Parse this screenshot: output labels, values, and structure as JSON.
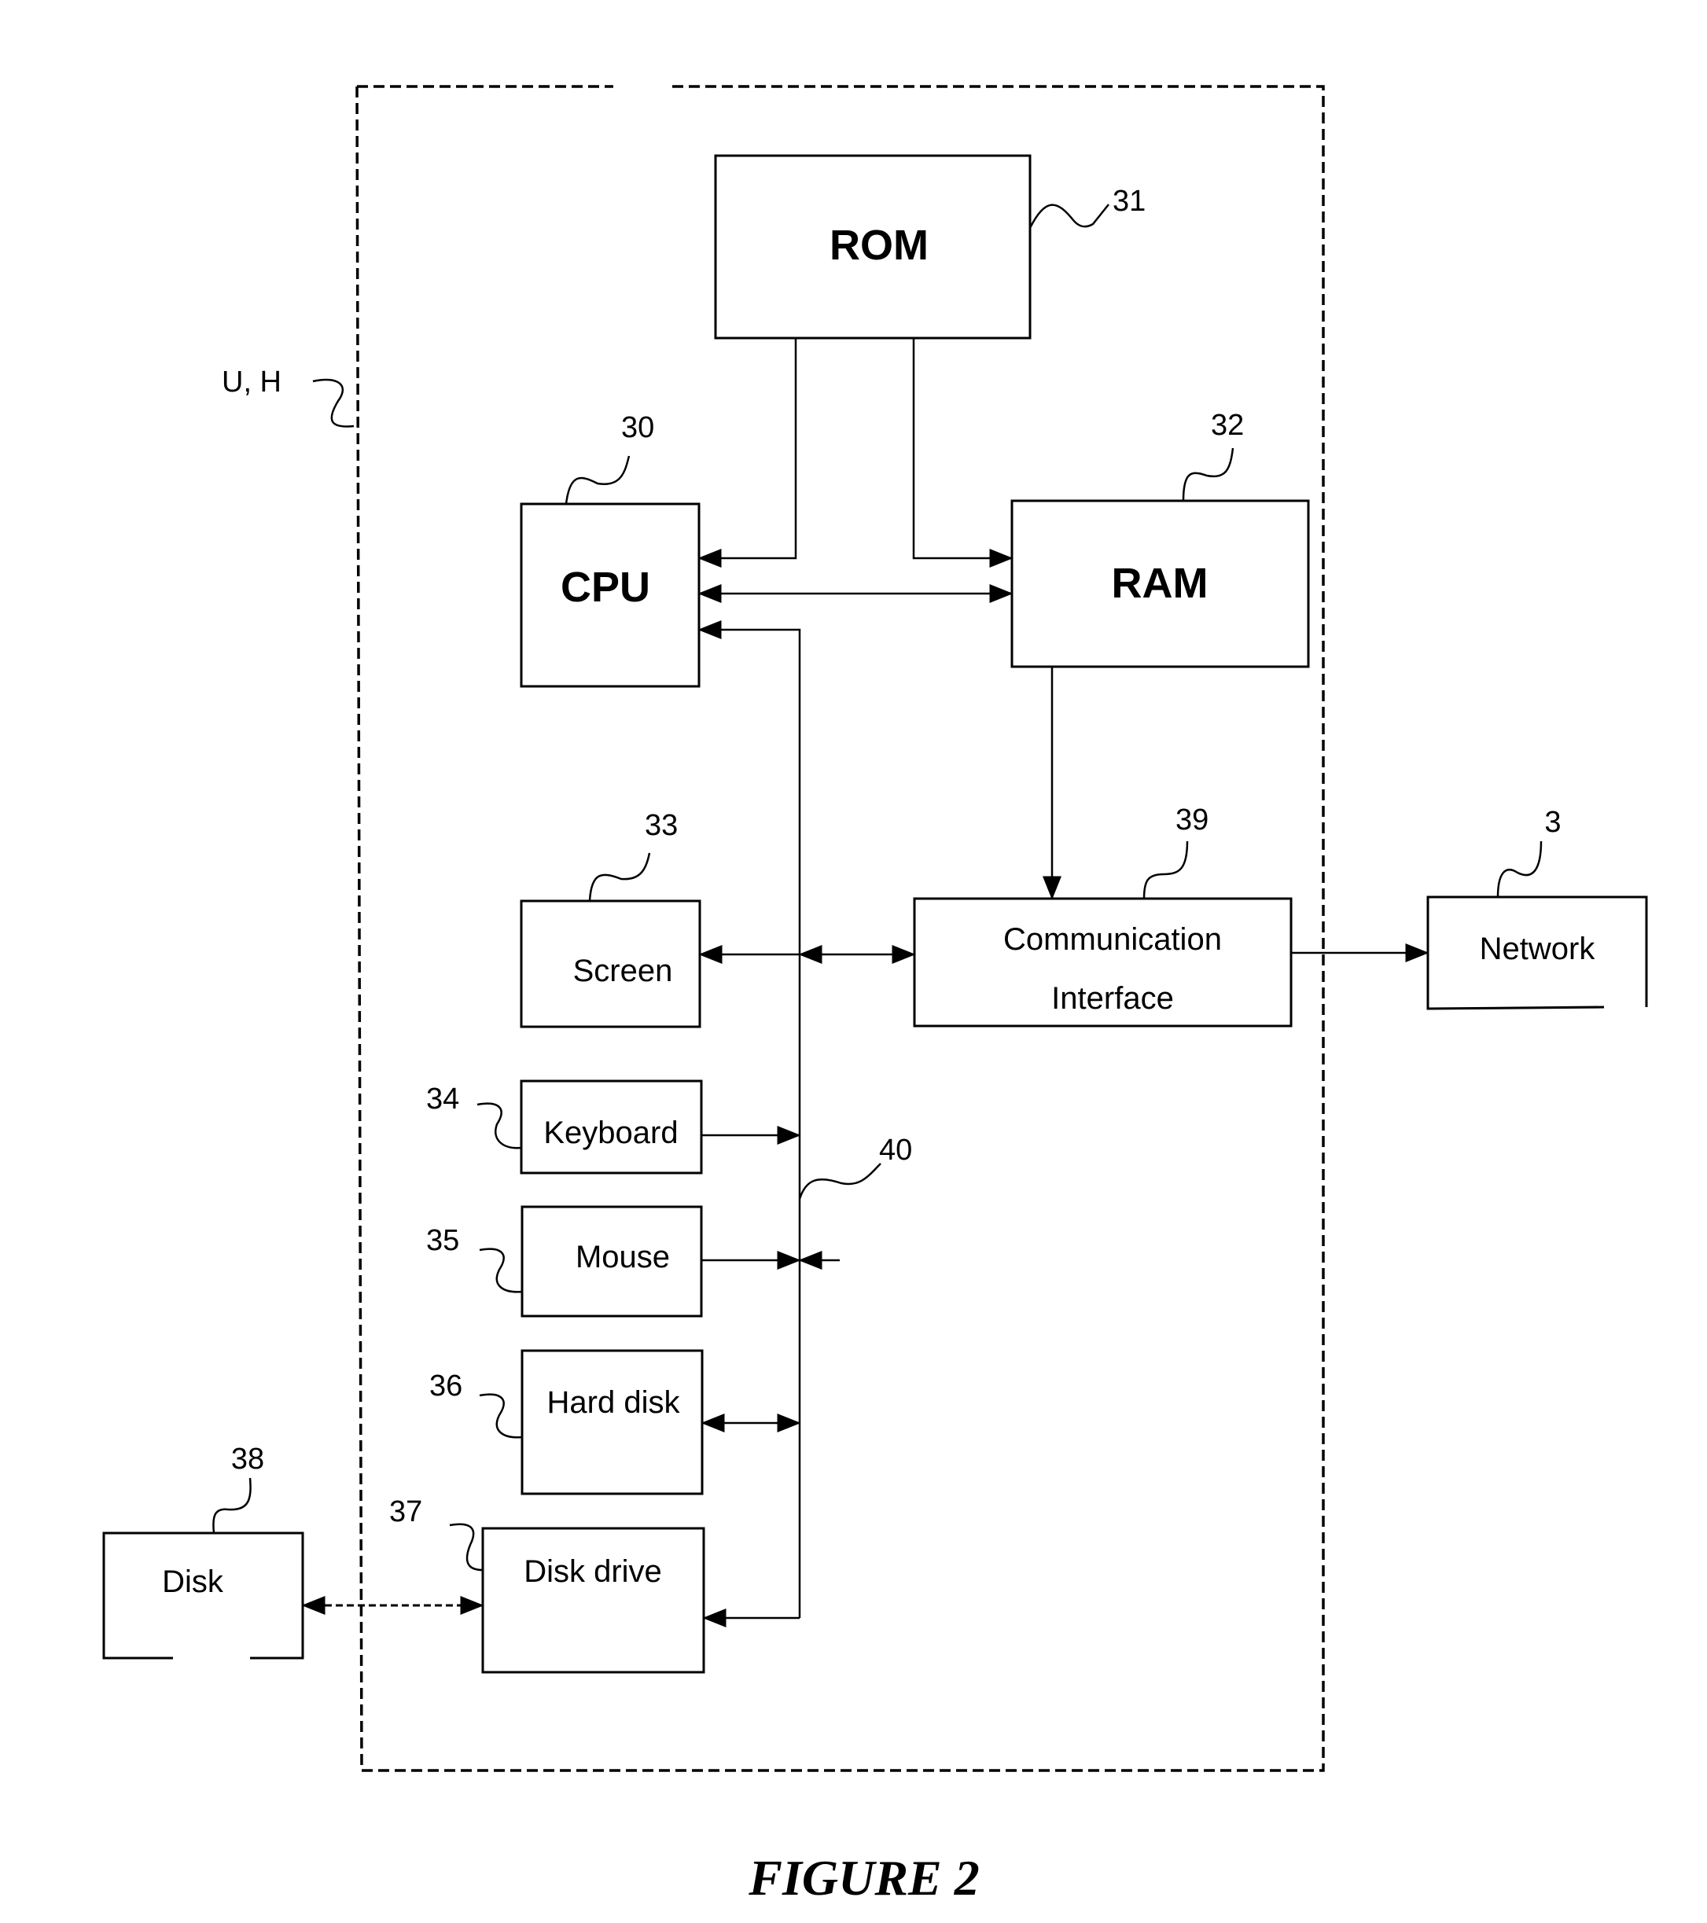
{
  "figure": {
    "caption": "FIGURE 2",
    "system_ref": "U, H"
  },
  "blocks": {
    "rom": {
      "label": "ROM",
      "ref": "31"
    },
    "cpu": {
      "label": "CPU",
      "ref": "30"
    },
    "ram": {
      "label": "RAM",
      "ref": "32"
    },
    "screen": {
      "label": "Screen",
      "ref": "33"
    },
    "comm": {
      "label_line1": "Communication",
      "label_line2": "Interface",
      "ref": "39"
    },
    "network": {
      "label": "Network",
      "ref": "3"
    },
    "keyboard": {
      "label": "Keyboard",
      "ref": "34"
    },
    "mouse": {
      "label": "Mouse",
      "ref": "35"
    },
    "hard_disk": {
      "label": "Hard disk",
      "ref": "36"
    },
    "disk_drive": {
      "label": "Disk drive",
      "ref": "37"
    },
    "disk": {
      "label": "Disk",
      "ref": "38"
    }
  },
  "bus": {
    "ref": "40"
  }
}
